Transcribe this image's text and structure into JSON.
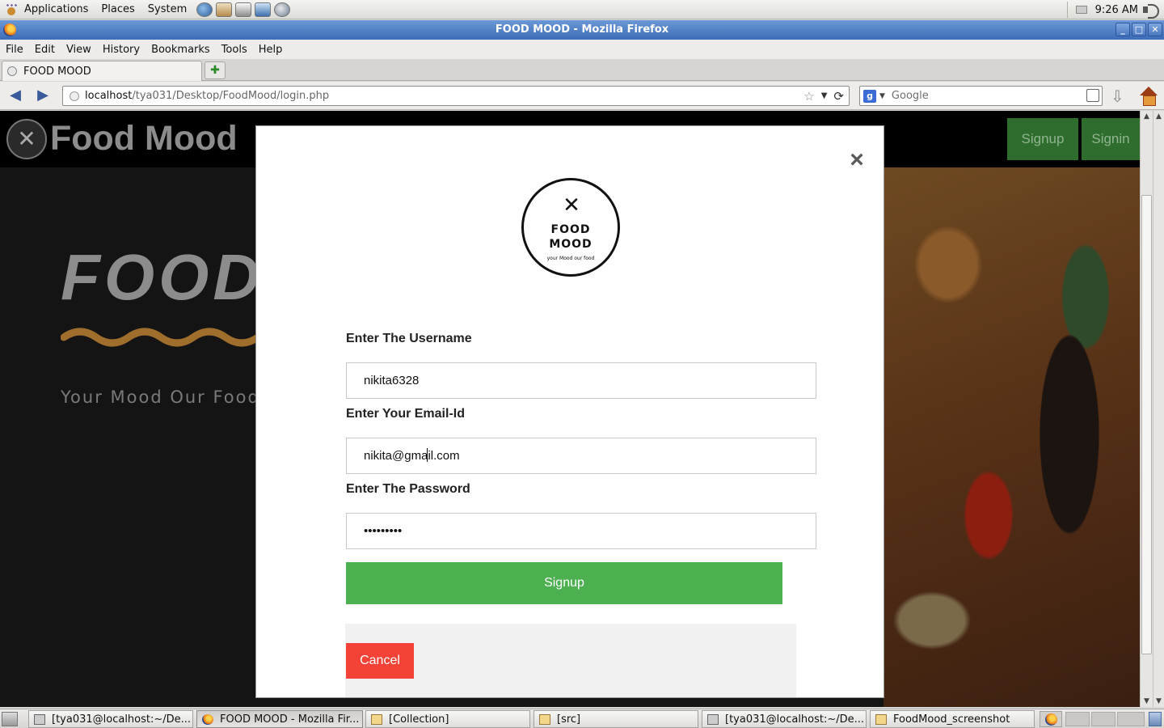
{
  "top_panel": {
    "menus": [
      "Applications",
      "Places",
      "System"
    ],
    "clock": "9:26 AM"
  },
  "window": {
    "title": "FOOD MOOD - Mozilla Firefox"
  },
  "menubar": {
    "items": [
      "File",
      "Edit",
      "View",
      "History",
      "Bookmarks",
      "Tools",
      "Help"
    ]
  },
  "tabs": [
    {
      "label": "FOOD MOOD",
      "active": true
    }
  ],
  "navbar": {
    "url_host": "localhost",
    "url_path": "/tya031/Desktop/FoodMood/login.php",
    "search_placeholder": "Google"
  },
  "site": {
    "title": "Food Mood",
    "header_buttons": [
      "Signup",
      "Signin"
    ],
    "hero_word": "FOOD",
    "tagline": "Your Mood Our Food",
    "accent_color": "#a06e2c"
  },
  "modal": {
    "close_symbol": "×",
    "logo": {
      "line1": "FOOD",
      "line2": "MOOD",
      "subtitle": "your Mood our food"
    },
    "fields": [
      {
        "label": "Enter The Username",
        "value": "nikita6328",
        "type": "text"
      },
      {
        "label": "Enter Your Email-Id",
        "value": "nikita@gmail.com",
        "type": "email"
      },
      {
        "label": "Enter The Password",
        "value": "•••••••••",
        "type": "password"
      }
    ],
    "submit_label": "Signup",
    "cancel_label": "Cancel",
    "submit_color": "#4caf50",
    "cancel_color": "#f44336"
  },
  "taskbar": {
    "tasks": [
      {
        "label": "[tya031@localhost:~/De...",
        "icon": "terminal-icon",
        "active": false
      },
      {
        "label": "FOOD MOOD - Mozilla Fir...",
        "icon": "firefox-icon",
        "active": true
      },
      {
        "label": "[Collection]",
        "icon": "folder-icon",
        "active": false
      },
      {
        "label": "[src]",
        "icon": "folder-icon",
        "active": false
      },
      {
        "label": "[tya031@localhost:~/De...",
        "icon": "terminal-icon",
        "active": false
      },
      {
        "label": "FoodMood_screenshot",
        "icon": "folder-icon",
        "active": false
      }
    ]
  }
}
